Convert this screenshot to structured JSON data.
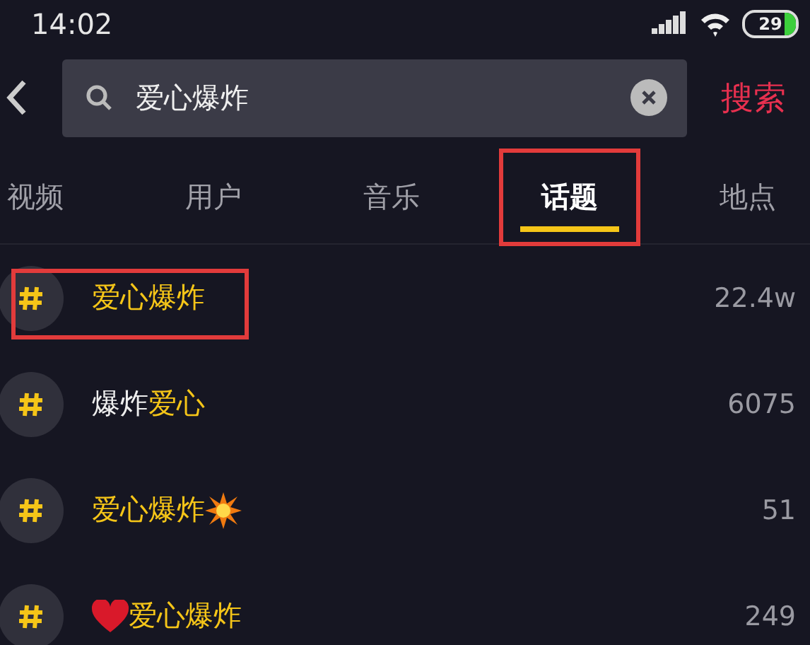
{
  "status_bar": {
    "time": "14:02",
    "battery": "29"
  },
  "search": {
    "value": "爱心爆炸",
    "submit": "搜索"
  },
  "tabs": [
    {
      "label": "视频",
      "selected": false,
      "annotated": false
    },
    {
      "label": "用户",
      "selected": false,
      "annotated": false
    },
    {
      "label": "音乐",
      "selected": false,
      "annotated": false
    },
    {
      "label": "话题",
      "selected": true,
      "annotated": true
    },
    {
      "label": "地点",
      "selected": false,
      "annotated": false
    }
  ],
  "topics": [
    {
      "annotated": true,
      "name": [
        {
          "kind": "match",
          "text": "爱心爆炸"
        }
      ],
      "count": "22.4w"
    },
    {
      "annotated": false,
      "name": [
        {
          "kind": "plain",
          "text": "爆炸"
        },
        {
          "kind": "match",
          "text": "爱心"
        }
      ],
      "count": "6075"
    },
    {
      "annotated": false,
      "name": [
        {
          "kind": "match",
          "text": "爱心爆炸"
        },
        {
          "kind": "burst"
        }
      ],
      "count": "51"
    },
    {
      "annotated": false,
      "name": [
        {
          "kind": "heart"
        },
        {
          "kind": "match",
          "text": "爱心爆炸"
        }
      ],
      "count": "249"
    }
  ]
}
